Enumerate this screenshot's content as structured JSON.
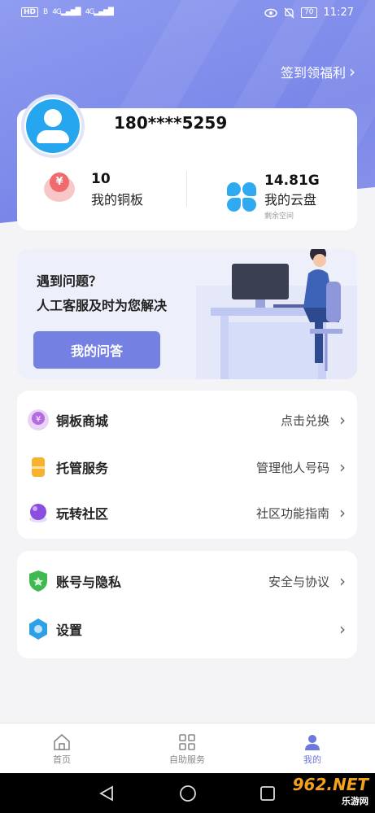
{
  "status_bar": {
    "network": "HD",
    "network_sub": "B",
    "signal1": "4G",
    "signal2": "4G",
    "battery": "70",
    "time": "11:27"
  },
  "header": {
    "signin_label": "签到领福利",
    "chevron": "›"
  },
  "profile": {
    "phone": "180****5259",
    "copper": {
      "value": "10",
      "label": "我的铜板",
      "icon_char": "¥"
    },
    "cloud": {
      "value": "14.81G",
      "label": "我的云盘",
      "sub": "剩余空间"
    }
  },
  "help": {
    "title": "遇到问题？",
    "subtitle": "人工客服及时为您解决",
    "button": "我的问答"
  },
  "menu1": [
    {
      "label": "铜板商城",
      "right": "点击兑换",
      "chev": "›"
    },
    {
      "label": "托管服务",
      "right": "管理他人号码",
      "chev": "›"
    },
    {
      "label": "玩转社区",
      "right": "社区功能指南",
      "chev": "›"
    }
  ],
  "menu2": [
    {
      "label": "账号与隐私",
      "right": "安全与协议",
      "chev": "›"
    },
    {
      "label": "设置",
      "right": "",
      "chev": "›"
    }
  ],
  "tabbar": {
    "home": "首页",
    "self_service": "自助服务",
    "mine": "我的"
  },
  "watermark": {
    "main": "962.NET",
    "sub": "乐游网"
  },
  "colors": {
    "accent": "#7480e2",
    "hero": "#8f9cf0",
    "tab_active": "#6d78dd"
  }
}
